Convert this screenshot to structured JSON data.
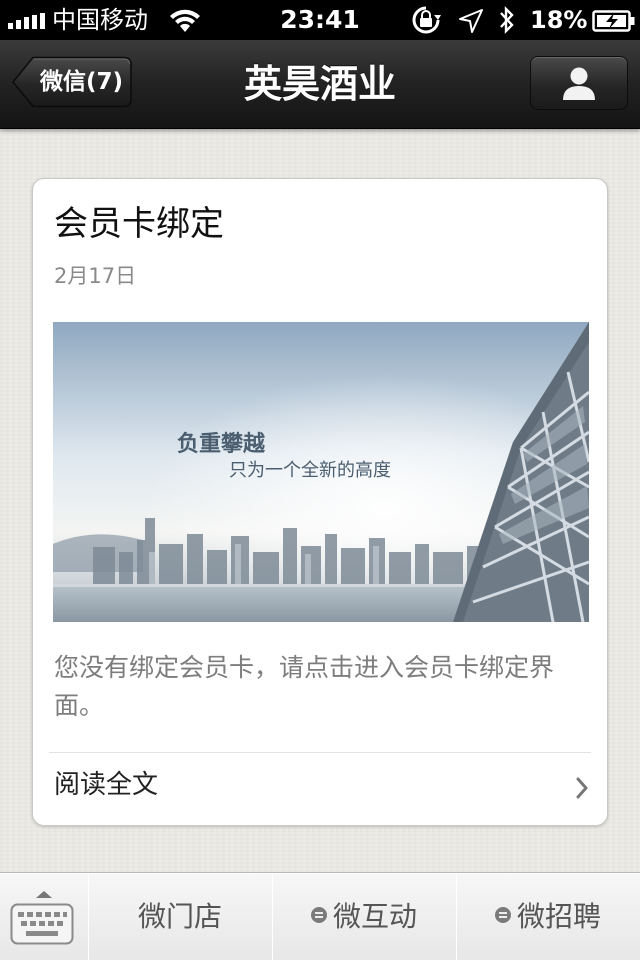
{
  "status_bar": {
    "carrier": "中国移动",
    "time": "23:41",
    "battery_percent": "18%",
    "icons": [
      "signal-icon",
      "wifi-icon",
      "orientation-lock-icon",
      "location-icon",
      "bluetooth-icon",
      "battery-icon"
    ]
  },
  "nav": {
    "back_label": "微信(7)",
    "title": "英昊酒业",
    "profile_icon": "person-icon"
  },
  "card": {
    "title": "会员卡绑定",
    "date": "2月17日",
    "image": {
      "headline": "负重攀越",
      "subline": "只为一个全新的高度"
    },
    "description": "您没有绑定会员卡，请点击进入会员卡绑定界面。",
    "read_more": "阅读全文"
  },
  "bottom_menu": {
    "keyboard_icon": "keyboard-icon",
    "items": [
      {
        "label": "微门店",
        "has_submenu": false
      },
      {
        "label": "微互动",
        "has_submenu": true
      },
      {
        "label": "微招聘",
        "has_submenu": true
      }
    ]
  },
  "colors": {
    "nav_background": "#222222",
    "page_background": "#ecebe6",
    "card_background": "#ffffff",
    "muted_text": "#8a8a8a"
  }
}
